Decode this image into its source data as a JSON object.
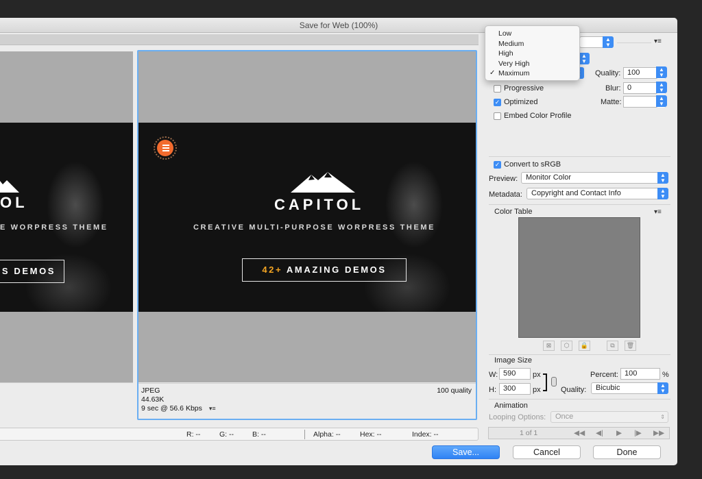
{
  "window": {
    "title": "Save for Web (100%)"
  },
  "preview": {
    "left_brand": "OL",
    "left_tagline": "E WORPRESS THEME",
    "left_button": "S DEMOS",
    "brand": "CAPITOL",
    "tagline": "CREATIVE MULTI-PURPOSE WORPRESS THEME",
    "button_accent": "42+",
    "button_text": "AMAZING DEMOS",
    "info": {
      "format": "JPEG",
      "size": "44.63K",
      "time": "9 sec @ 56.6 Kbps",
      "quality": "100 quality"
    }
  },
  "statusbar": {
    "r": "R: --",
    "g": "G: --",
    "b": "B: --",
    "alpha": "Alpha: --",
    "hex": "Hex: --",
    "index": "Index: --"
  },
  "dropdown": {
    "options": [
      "Low",
      "Medium",
      "High",
      "Very High",
      "Maximum"
    ],
    "selected": "Maximum"
  },
  "settings": {
    "quality_label": "Quality:",
    "quality_value": "100",
    "blur_label": "Blur:",
    "blur_value": "0",
    "matte_label": "Matte:",
    "matte_value": "",
    "progressive": "Progressive",
    "optimized": "Optimized",
    "embed_profile": "Embed Color Profile",
    "convert_srgb": "Convert to sRGB",
    "preview_label": "Preview:",
    "preview_value": "Monitor Color",
    "metadata_label": "Metadata:",
    "metadata_value": "Copyright and Contact Info"
  },
  "color_table": {
    "title": "Color Table"
  },
  "image_size": {
    "title": "Image Size",
    "w_label": "W:",
    "w_value": "590",
    "w_unit": "px",
    "h_label": "H:",
    "h_value": "300",
    "h_unit": "px",
    "percent_label": "Percent:",
    "percent_value": "100",
    "percent_unit": "%",
    "quality_label": "Quality:",
    "quality_value": "Bicubic"
  },
  "animation": {
    "title": "Animation",
    "looping_label": "Looping Options:",
    "looping_value": "Once",
    "frame": "1 of 1"
  },
  "buttons": {
    "save": "Save...",
    "cancel": "Cancel",
    "done": "Done"
  },
  "colors": {
    "accent": "#3d8df5",
    "brand_orange": "#f26b2e",
    "demo_accent": "#f5a623"
  }
}
